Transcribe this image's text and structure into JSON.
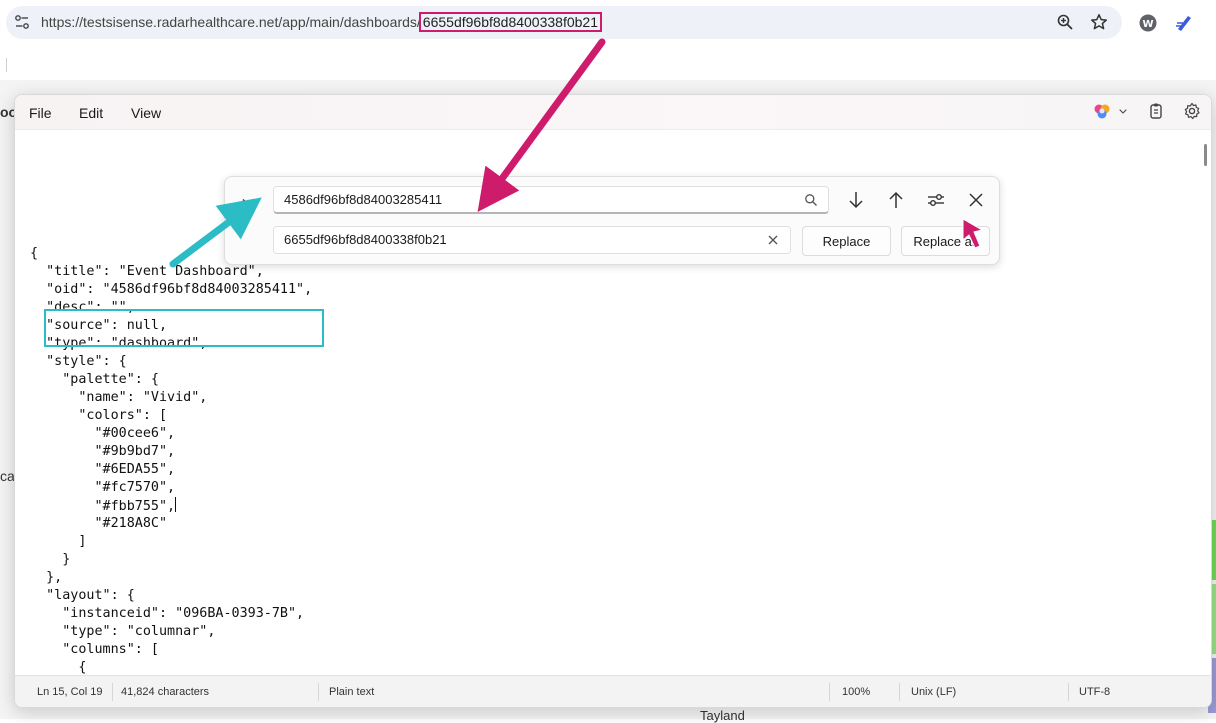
{
  "browser": {
    "url_base": "https://testsisense.radarhealthcare.net/app/main/dashboards/",
    "url_id": "6655df96bf8d8400338f0b21"
  },
  "background": {
    "left_fragment_top": "oo",
    "left_fragment_mid": "ca",
    "bottom_text": "Tayland"
  },
  "notepad": {
    "menu": {
      "file": "File",
      "edit": "Edit",
      "view": "View"
    },
    "find": {
      "find_value": "4586df96bf8d84003285411",
      "replace_value": "6655df96bf8d8400338f0b21",
      "replace_label": "Replace",
      "replace_all_label": "Replace all"
    },
    "code_lines": [
      "{",
      "  \"title\": \"Event Dashboard\",",
      "  \"oid\": \"4586df96bf8d84003285411\",",
      "  \"desc\": \"\",",
      "  \"source\": null,",
      "  \"type\": \"dashboard\",",
      "  \"style\": {",
      "    \"palette\": {",
      "      \"name\": \"Vivid\",",
      "      \"colors\": [",
      "        \"#00cee6\",",
      "        \"#9b9bd7\",",
      "        \"#6EDA55\",",
      "        \"#fc7570\",",
      "        \"#fbb755\",",
      "        \"#218A8C\"",
      "      ]",
      "    }",
      "  },",
      "  \"layout\": {",
      "    \"instanceid\": \"096BA-0393-7B\",",
      "    \"type\": \"columnar\",",
      "    \"columns\": [",
      "      {"
    ],
    "status": {
      "position": "Ln 15, Col 19",
      "characters": "41,824 characters",
      "format": "Plain text",
      "zoom": "100%",
      "line_ending": "Unix (LF)",
      "encoding": "UTF-8"
    }
  },
  "colors": {
    "annotation_magenta": "#cf1b6c",
    "annotation_teal": "#2bbcc6"
  }
}
